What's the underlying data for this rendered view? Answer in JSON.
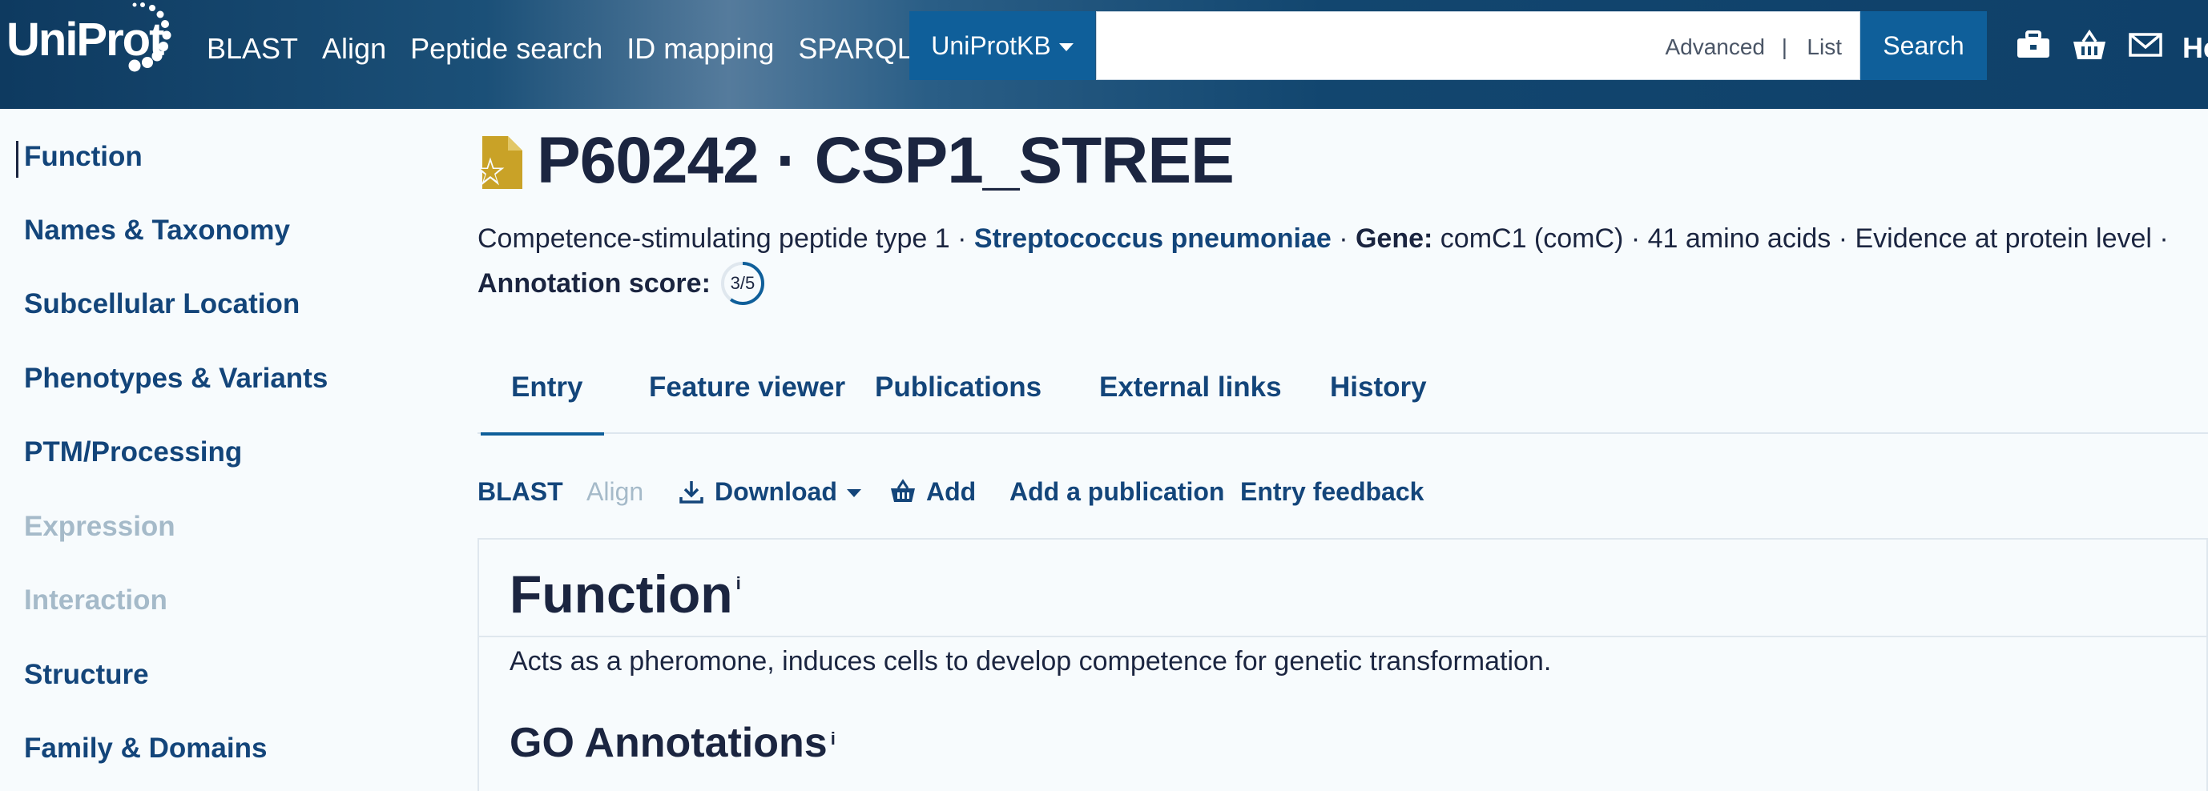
{
  "header": {
    "logo_text": "UniProt",
    "nav": [
      "BLAST",
      "Align",
      "Peptide search",
      "ID mapping",
      "SPARQL"
    ],
    "database_select": "UniProtKB",
    "search_placeholder": "",
    "advanced_label": "Advanced",
    "separator": "|",
    "list_label": "List",
    "search_button": "Search",
    "icons": [
      "toolkit-icon",
      "basket-icon",
      "mail-icon"
    ],
    "help_partial": "He"
  },
  "sidebar": {
    "items": [
      {
        "label": "Function",
        "enabled": true,
        "active": true
      },
      {
        "label": "Names & Taxonomy",
        "enabled": true
      },
      {
        "label": "Subcellular Location",
        "enabled": true
      },
      {
        "label": "Phenotypes & Variants",
        "enabled": true
      },
      {
        "label": "PTM/Processing",
        "enabled": true
      },
      {
        "label": "Expression",
        "enabled": false
      },
      {
        "label": "Interaction",
        "enabled": false
      },
      {
        "label": "Structure",
        "enabled": true
      },
      {
        "label": "Family & Domains",
        "enabled": true
      }
    ]
  },
  "entry": {
    "title": "P60242 · CSP1_STREE",
    "protein_name": "Competence-stimulating peptide type 1",
    "dot": " · ",
    "organism": "Streptococcus pneumoniae",
    "gene_label": "Gene:",
    "gene_value": " comC1 (comC)",
    "length": "41 amino acids",
    "evidence": "Evidence at protein level",
    "annotation_score_label": "Annotation score:",
    "annotation_score": "3/5",
    "annotation_score_fraction": 0.6
  },
  "tabs": [
    {
      "label": "Entry",
      "active": true
    },
    {
      "label": "Feature viewer"
    },
    {
      "label": "Publications"
    },
    {
      "label": "External links"
    },
    {
      "label": "History"
    }
  ],
  "actions": {
    "blast": "BLAST",
    "align": "Align",
    "download": "Download",
    "add": "Add",
    "add_publication": "Add a publication",
    "entry_feedback": "Entry feedback"
  },
  "function_section": {
    "title": "Function",
    "info": "i",
    "text": "Acts as a pheromone, induces cells to develop competence for genetic transformation.",
    "go_title": "GO Annotations",
    "go_info": "i"
  },
  "colors": {
    "header_dark": "#0e3a60",
    "accent": "#0f5f9a",
    "link": "#13457a",
    "disabled": "#a5bac9",
    "reviewed_icon": "#c9a227"
  }
}
